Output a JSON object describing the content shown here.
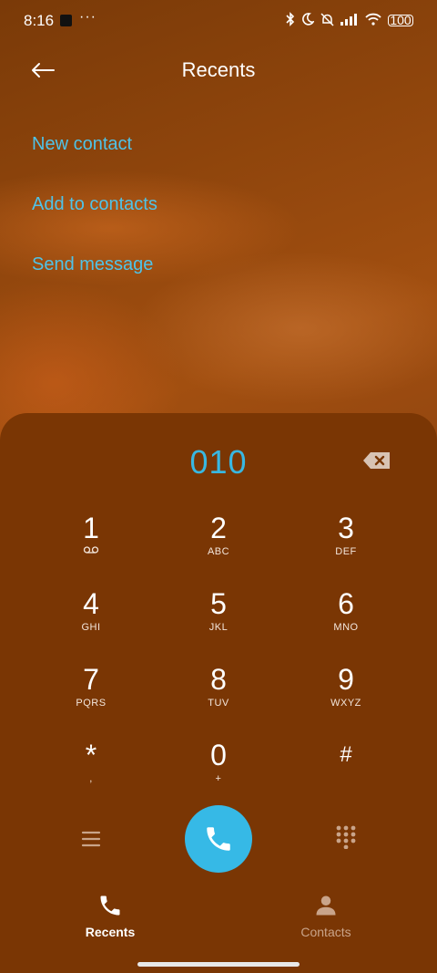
{
  "status_bar": {
    "time": "8:16",
    "dots": "···",
    "battery": "100"
  },
  "header": {
    "title": "Recents"
  },
  "actions": {
    "new_contact": "New contact",
    "add_to_contacts": "Add to contacts",
    "send_message": "Send message"
  },
  "dialer": {
    "number": "010",
    "keys": [
      {
        "digit": "1",
        "letters": ""
      },
      {
        "digit": "2",
        "letters": "ABC"
      },
      {
        "digit": "3",
        "letters": "DEF"
      },
      {
        "digit": "4",
        "letters": "GHI"
      },
      {
        "digit": "5",
        "letters": "JKL"
      },
      {
        "digit": "6",
        "letters": "MNO"
      },
      {
        "digit": "7",
        "letters": "PQRS"
      },
      {
        "digit": "8",
        "letters": "TUV"
      },
      {
        "digit": "9",
        "letters": "WXYZ"
      },
      {
        "digit": "*",
        "letters": ","
      },
      {
        "digit": "0",
        "letters": "+"
      },
      {
        "digit": "#",
        "letters": ""
      }
    ]
  },
  "bottom_nav": {
    "recents": "Recents",
    "contacts": "Contacts"
  },
  "colors": {
    "accent": "#38b8e2",
    "background": "#7a3604"
  }
}
